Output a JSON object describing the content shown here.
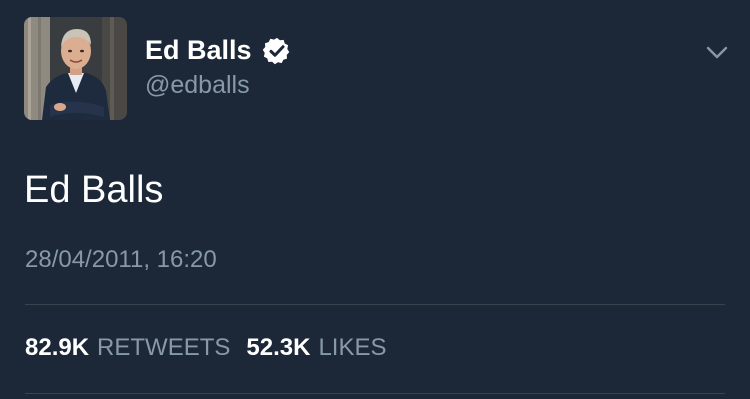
{
  "tweet": {
    "author": {
      "display_name": "Ed Balls",
      "handle": "@edballs",
      "verified": true
    },
    "text": "Ed Balls",
    "timestamp": "28/04/2011, 16:20",
    "stats": {
      "retweets_count": "82.9K",
      "retweets_label": "RETWEETS",
      "likes_count": "52.3K",
      "likes_label": "LIKES"
    }
  },
  "colors": {
    "background": "#1c2838",
    "primary_text": "#ffffff",
    "secondary_text": "#8899a6",
    "divider": "#38444d"
  },
  "icons": {
    "verified": "verified-badge-icon",
    "menu": "chevron-down-icon"
  }
}
